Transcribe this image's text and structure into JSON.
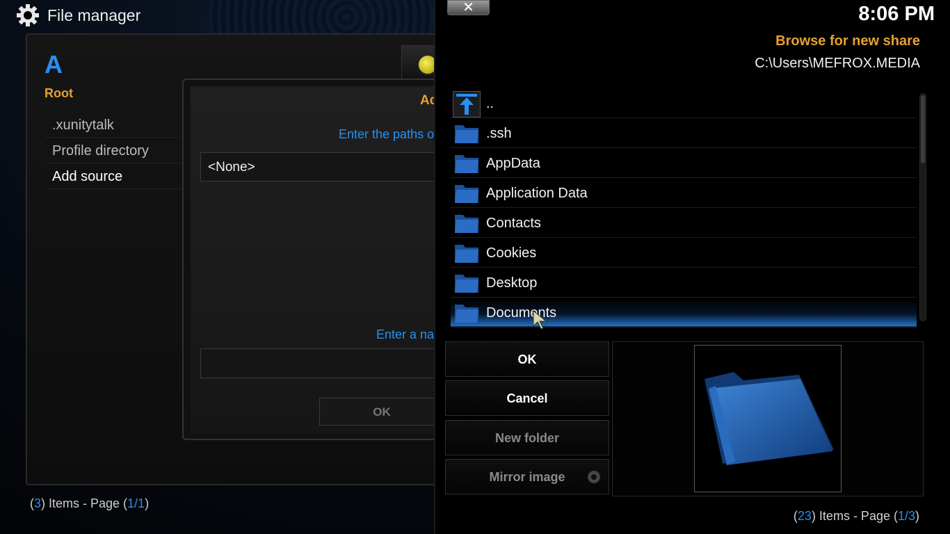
{
  "app": {
    "title": "File manager",
    "gear_icon": "gear-icon"
  },
  "left": {
    "letter": "A",
    "root_label": "Root",
    "items": [
      ".xunitytalk",
      "Profile directory",
      "Add source"
    ],
    "footer": {
      "open": "(",
      "count": "3",
      "mid": ") Items - Page (",
      "page": "1/1",
      "close": ")"
    }
  },
  "add_source_dialog": {
    "title": "Ad",
    "paths_prompt": "Enter the paths or",
    "path_value": "<None>",
    "name_prompt": "Enter a na",
    "ok_label": "OK"
  },
  "browse": {
    "clock": "8:06 PM",
    "title": "Browse for new share",
    "path": "C:\\Users\\MEFROX.MEDIA",
    "close_glyph": "✕",
    "items": [
      "..",
      ".ssh",
      "AppData",
      "Application Data",
      "Contacts",
      "Cookies",
      "Desktop",
      "Documents"
    ],
    "selected_index": 7,
    "buttons": {
      "ok": "OK",
      "cancel": "Cancel",
      "new_folder": "New folder",
      "mirror_image": "Mirror image"
    },
    "footer": {
      "open": "(",
      "count": "23",
      "mid": ") Items - Page (",
      "page": "1/3",
      "close": ")"
    },
    "colors": {
      "accent_blue": "#2a8ff0",
      "title_orange": "#e8a030"
    }
  }
}
